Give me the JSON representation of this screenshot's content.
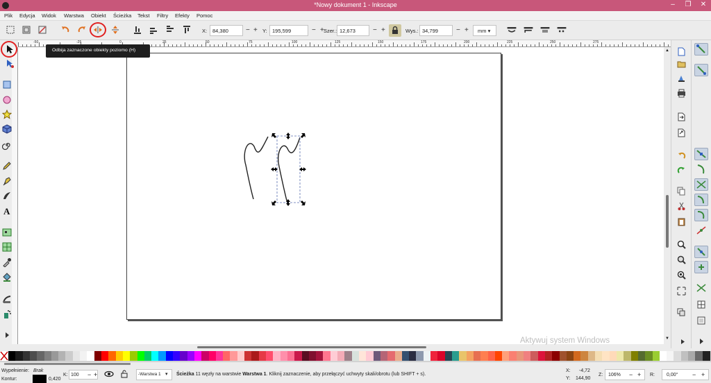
{
  "window": {
    "title": "*Nowy dokument 1 - Inkscape",
    "controls": [
      "–",
      "❐",
      "✕"
    ]
  },
  "menu": [
    "Plik",
    "Edycja",
    "Widok",
    "Warstwa",
    "Obiekt",
    "Ścieżka",
    "Tekst",
    "Filtry",
    "Efekty",
    "Pomoc"
  ],
  "toolbar": {
    "x": {
      "label": "X:",
      "value": "84,380"
    },
    "y": {
      "label": "Y:",
      "value": "195,599"
    },
    "w": {
      "label": "Szer.:",
      "value": "12,673"
    },
    "h": {
      "label": "Wys.:",
      "value": "34,799"
    },
    "unit": "mm"
  },
  "tooltip": "Odbija zaznaczone obiekty poziomo (H)",
  "ruler_labels": [
    "-50",
    "-25",
    "0",
    "25",
    "50",
    "75",
    "100",
    "125",
    "150",
    "175",
    "200",
    "225",
    "250",
    "275"
  ],
  "watermark": "Aktywuj system Windows",
  "status": {
    "fill_label": "Wypełnienie:",
    "fill_value": "Brak",
    "stroke_label": "Kontur:",
    "stroke_width": "0,420",
    "opacity_label": "K:",
    "opacity_value": "100",
    "layer": "-Warstwa 1",
    "message_bold": "Ścieżka",
    "message_mid": " 11 węzły na warstwie ",
    "message_layer": "Warstwa 1",
    "message_rest": ". Kliknij zaznaczenie, aby przełączyć uchwyty skali/obrotu (lub SHIFT + s).",
    "x_label": "X:",
    "x_value": "-4,72",
    "y_label": "Y:",
    "y_value": "144,90",
    "z_label": "Z:",
    "zoom": "106%",
    "r_label": "R:",
    "rotation": "0,00°"
  },
  "colors": {
    "titlebar": "#c8577a",
    "selection_handle": "#000000",
    "highlight_circle": "#e02020"
  }
}
